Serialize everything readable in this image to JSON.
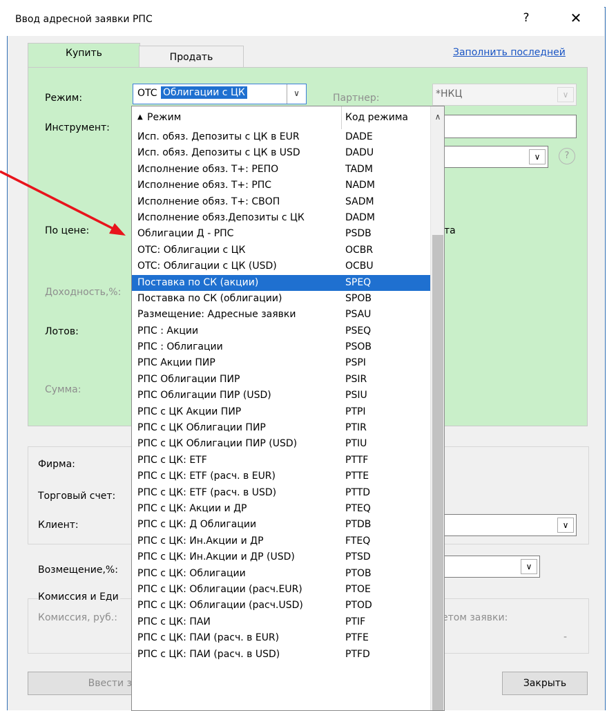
{
  "dialog": {
    "title": "Ввод адресной заявки РПС",
    "help_label": "?",
    "close_label": "✕"
  },
  "tabs": [
    {
      "label": "Купить",
      "active": true
    },
    {
      "label": "Продать",
      "active": false
    }
  ],
  "fill_last_link": "Заполнить последней",
  "form": {
    "mode_label": "Режим:",
    "mode_value_prefix": "OTC",
    "mode_value_selected": "Облигации с ЦК",
    "partner_label": "Партнер:",
    "partner_value": "*НКЦ",
    "instrument_label": "Инструмент:",
    "price_label": "По цене:",
    "price_option_fragment": "та",
    "yield_label": "Доходность,%:",
    "lots_label": "Лотов:",
    "sum_label": "Сумма:",
    "help_icon_glyph": "?"
  },
  "lower": {
    "firm_label": "Фирма:",
    "account_label": "Торговый счет:",
    "client_label": "Клиент:",
    "refund_label": "Возмещение,%:",
    "commission_group_label": "Комиссия и Еди",
    "commission_label": "Комиссия, руб.:",
    "order_amount_fragment": "етом заявки:",
    "dash": "-",
    "submit_button": "Ввести з",
    "close_button": "Закрыть"
  },
  "dropdown": {
    "header_mode": "Режим",
    "header_code": "Код режима",
    "selected_index": 9,
    "rows": [
      {
        "name": "Исп. обяз. Депозиты с ЦК в EUR",
        "code": "DADE"
      },
      {
        "name": "Исп. обяз. Депозиты с ЦК в USD",
        "code": "DADU"
      },
      {
        "name": "Исполнение обяз. Т+: РЕПО",
        "code": "TADM"
      },
      {
        "name": "Исполнение обяз. Т+: РПС",
        "code": "NADM"
      },
      {
        "name": "Исполнение обяз. Т+: СВОП",
        "code": "SADM"
      },
      {
        "name": "Исполнение обяз.Депозиты с ЦК",
        "code": "DADM"
      },
      {
        "name": "Облигации Д - РПС",
        "code": "PSDB"
      },
      {
        "name": "OTC: Облигации с ЦК",
        "code": "OCBR"
      },
      {
        "name": "OTC: Облигации с ЦК (USD)",
        "code": "OCBU"
      },
      {
        "name": "Поставка по СК (акции)",
        "code": "SPEQ"
      },
      {
        "name": "Поставка по СК (облигации)",
        "code": "SPOB"
      },
      {
        "name": "Размещение: Адресные заявки",
        "code": "PSAU"
      },
      {
        "name": "РПС : Акции",
        "code": "PSEQ"
      },
      {
        "name": "РПС : Облигации",
        "code": "PSOB"
      },
      {
        "name": "РПС Акции ПИР",
        "code": "PSPI"
      },
      {
        "name": "РПС Облигации ПИР",
        "code": "PSIR"
      },
      {
        "name": "РПС Облигации ПИР (USD)",
        "code": "PSIU"
      },
      {
        "name": "РПС с ЦК Акции ПИР",
        "code": "PTPI"
      },
      {
        "name": "РПС с ЦК Облигации ПИР",
        "code": "PTIR"
      },
      {
        "name": "РПС с ЦК Облигации ПИР (USD)",
        "code": "PTIU"
      },
      {
        "name": "РПС с ЦК: ETF",
        "code": "PTTF"
      },
      {
        "name": "РПС с ЦК: ETF (расч. в EUR)",
        "code": "PTTE"
      },
      {
        "name": "РПС с ЦК: ETF (расч. в USD)",
        "code": "PTTD"
      },
      {
        "name": "РПС с ЦК: Акции и ДР",
        "code": "PTEQ"
      },
      {
        "name": "РПС с ЦК: Д Облигации",
        "code": "PTDB"
      },
      {
        "name": "РПС с ЦК: Ин.Акции и ДР",
        "code": "FTEQ"
      },
      {
        "name": "РПС с ЦК: Ин.Акции и ДР (USD)",
        "code": "PTSD"
      },
      {
        "name": "РПС с ЦК: Облигации",
        "code": "PTOB"
      },
      {
        "name": "РПС с ЦК: Облигации (расч.EUR)",
        "code": "PTOE"
      },
      {
        "name": "РПС с ЦК: Облигации (расч.USD)",
        "code": "PTOD"
      },
      {
        "name": "РПС с ЦК: ПАИ",
        "code": "PTIF"
      },
      {
        "name": "РПС с ЦК: ПАИ (расч. в EUR)",
        "code": "PTFE"
      },
      {
        "name": "РПС с ЦК: ПАИ (расч. в USD)",
        "code": "PTFD"
      }
    ]
  },
  "colors": {
    "panel_green": "#c9efc9",
    "selection_blue": "#1f70d0",
    "link_blue": "#1a55c4",
    "annotation_arrow": "#e8141c"
  },
  "icons": {
    "sort_up": "▲",
    "scroll_up": "∧",
    "combo_arrow": "∨"
  }
}
